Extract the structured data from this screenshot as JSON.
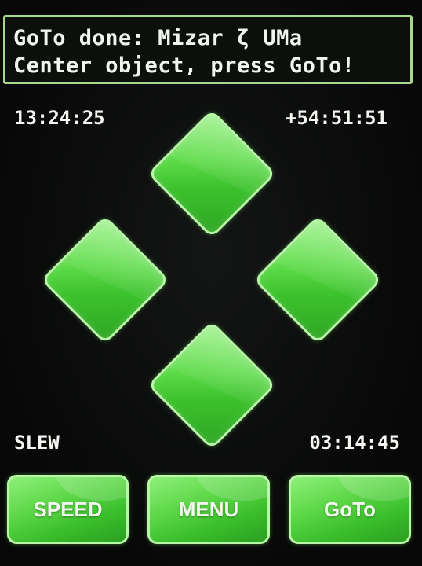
{
  "status": {
    "line1": "GoTo done: Mizar ζ UMa",
    "line2": "Center object, press GoTo!"
  },
  "readouts": {
    "time": "13:24:25",
    "declination": "+54:51:51",
    "mode": "SLEW",
    "remaining": "03:14:45"
  },
  "dpad": {
    "color": "#5fdc4a",
    "border_color": "#b9f7a8"
  },
  "buttons": {
    "speed": "SPEED",
    "menu": "MENU",
    "goto": "GoTo"
  }
}
